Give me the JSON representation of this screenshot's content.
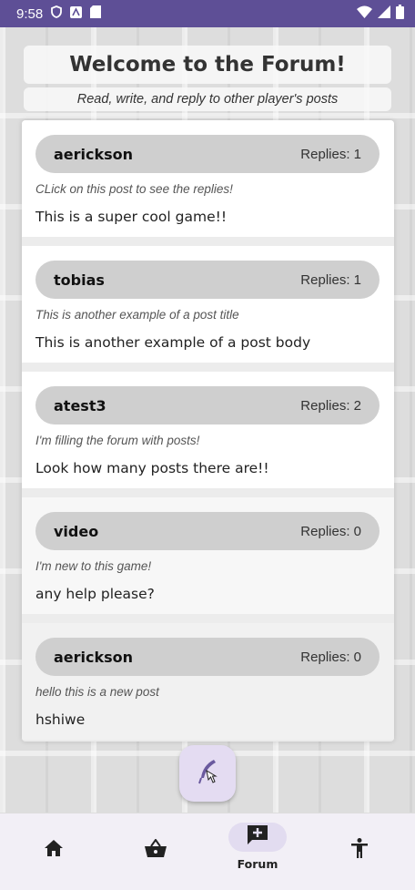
{
  "status_bar": {
    "time": "9:58",
    "left_icons": [
      "vpn-shield-icon",
      "notification-app-icon",
      "sd-card-icon"
    ],
    "right_icons": [
      "wifi-icon",
      "cell-signal-icon",
      "battery-icon"
    ]
  },
  "header": {
    "title": "Welcome to the Forum!",
    "subtitle": "Read, write, and reply to other player's posts"
  },
  "replies_label": "Replies:",
  "posts": [
    {
      "user": "aerickson",
      "replies": "Replies: 1",
      "title": "CLick on this post to see the replies!",
      "body": "This is a super cool game!!"
    },
    {
      "user": "tobias",
      "replies": "Replies: 1",
      "title": "This is another example of a post title",
      "body": "This is another example of a post body"
    },
    {
      "user": "atest3",
      "replies": "Replies: 2",
      "title": "I'm filling the forum with posts!",
      "body": "Look how many posts there are!!"
    },
    {
      "user": "video",
      "replies": "Replies: 0",
      "title": "I'm new to this game!",
      "body": "any help please?"
    },
    {
      "user": "aerickson",
      "replies": "Replies: 0",
      "title": "hello this is a new post",
      "body": "hshiwe"
    }
  ],
  "fab": {
    "icon": "quill-pen-icon"
  },
  "nav": {
    "items": [
      {
        "icon": "home-icon",
        "label": ""
      },
      {
        "icon": "basket-icon",
        "label": ""
      },
      {
        "icon": "add-comment-icon",
        "label": "Forum",
        "active": true
      },
      {
        "icon": "accessibility-icon",
        "label": ""
      }
    ]
  },
  "colors": {
    "status_bar": "#5e4f96",
    "header_pill": "#cfcfcf",
    "fab_bg": "#e4dcf2",
    "nav_bg": "#f2eff6",
    "nav_active_pill": "#e2dcf0"
  }
}
